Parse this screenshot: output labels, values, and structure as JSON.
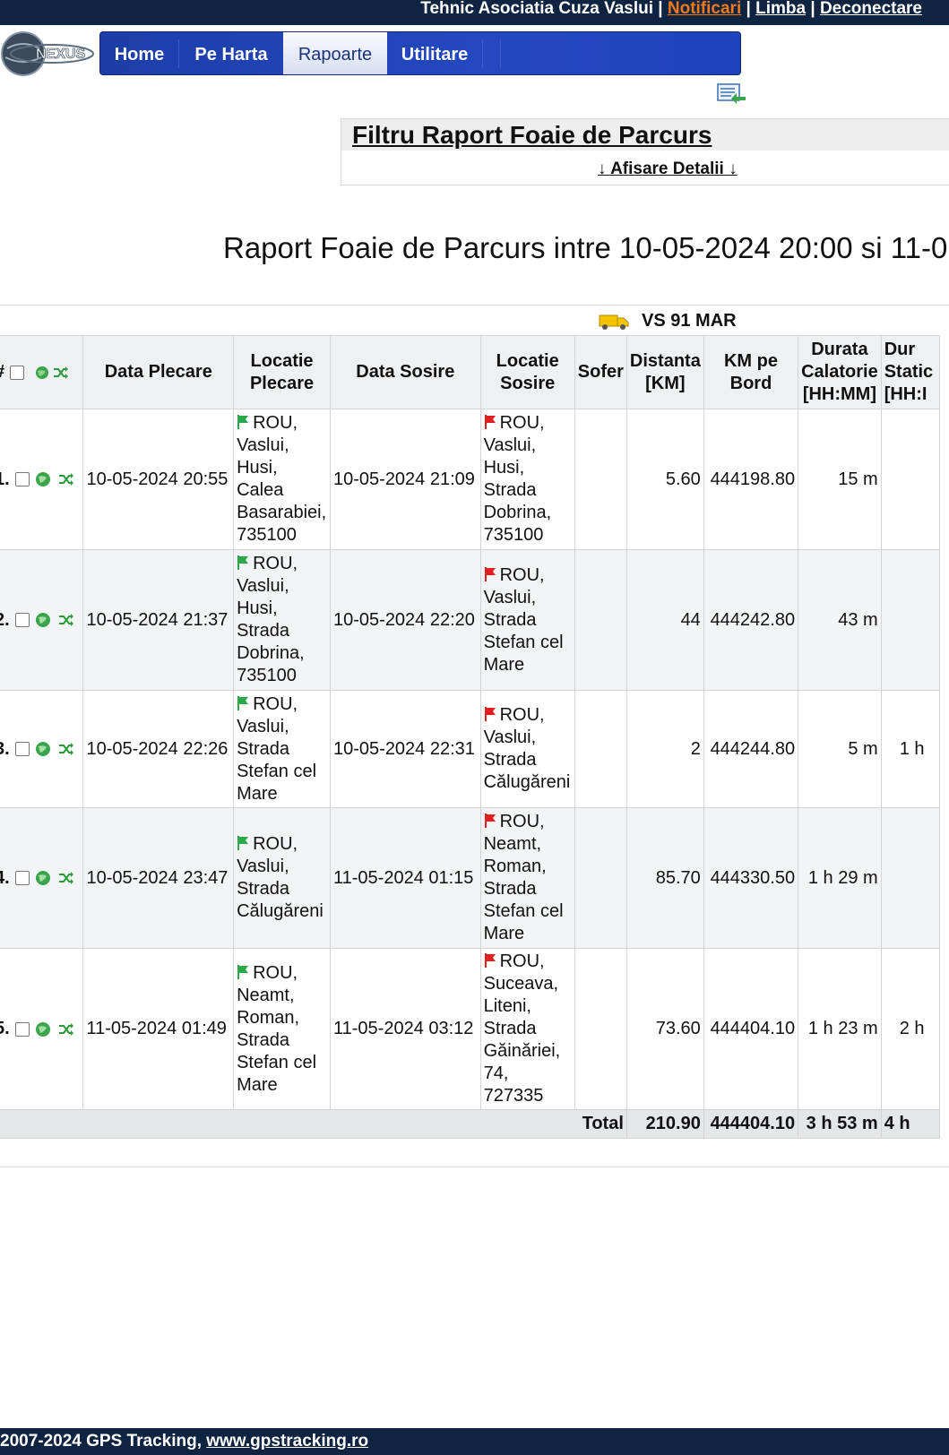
{
  "topbar": {
    "user": "Tehnic Asociatia Cuza Vaslui",
    "sep": " | ",
    "notifications": "Notificari",
    "language": "Limba",
    "logout": "Deconectare"
  },
  "nav": {
    "home": "Home",
    "map": "Pe Harta",
    "reports": "Rapoarte",
    "utilities": "Utilitare",
    "active": "Rapoarte"
  },
  "filter": {
    "title": "Filtru Raport Foaie de Parcurs",
    "details_link": "↓ Afisare Detalii ↓"
  },
  "report": {
    "title": "Raport Foaie de Parcurs intre 10-05-2024 20:00 si 11-0",
    "vehicle": "VS 91 MAR"
  },
  "columns": {
    "index": "#",
    "departure_date": "Data Plecare",
    "departure_location": "Locatie Plecare",
    "arrival_date": "Data Sosire",
    "arrival_location": "Locatie Sosire",
    "driver": "Sofer",
    "distance": "Distanta [KM]",
    "odometer": "KM pe Bord",
    "travel_duration": "Durata Calatorie [HH:MM]",
    "stop_duration": "Dur Static [HH:I"
  },
  "rows": [
    {
      "index": "1.",
      "departure_date": "10-05-2024 20:55",
      "departure_location": "ROU, Vaslui, Husi, Calea Basarabiei, 735100",
      "arrival_date": "10-05-2024 21:09",
      "arrival_location": "ROU, Vaslui, Husi, Strada Dobrina, 735100",
      "driver": "",
      "distance": "5.60",
      "odometer": "444198.80",
      "travel_duration": "15 m",
      "stop_duration": ""
    },
    {
      "index": "2.",
      "departure_date": "10-05-2024 21:37",
      "departure_location": "ROU, Vaslui, Husi, Strada Dobrina, 735100",
      "arrival_date": "10-05-2024 22:20",
      "arrival_location": "ROU, Vaslui, Strada Stefan cel Mare",
      "driver": "",
      "distance": "44",
      "odometer": "444242.80",
      "travel_duration": "43 m",
      "stop_duration": ""
    },
    {
      "index": "3.",
      "departure_date": "10-05-2024 22:26",
      "departure_location": "ROU, Vaslui, Strada Stefan cel Mare",
      "arrival_date": "10-05-2024 22:31",
      "arrival_location": "ROU, Vaslui, Strada Călugăreni",
      "driver": "",
      "distance": "2",
      "odometer": "444244.80",
      "travel_duration": "5 m",
      "stop_duration": "1 h"
    },
    {
      "index": "4.",
      "departure_date": "10-05-2024 23:47",
      "departure_location": "ROU, Vaslui, Strada Călugăreni",
      "arrival_date": "11-05-2024 01:15",
      "arrival_location": "ROU, Neamt, Roman, Strada Stefan cel Mare",
      "driver": "",
      "distance": "85.70",
      "odometer": "444330.50",
      "travel_duration": "1 h 29 m",
      "stop_duration": ""
    },
    {
      "index": "5.",
      "departure_date": "11-05-2024 01:49",
      "departure_location": "ROU, Neamt, Roman, Strada Stefan cel Mare",
      "arrival_date": "11-05-2024 03:12",
      "arrival_location": "ROU, Suceava, Liteni, Strada Găinăriei, 74, 727335",
      "driver": "",
      "distance": "73.60",
      "odometer": "444404.10",
      "travel_duration": "1 h 23 m",
      "stop_duration": "2 h"
    }
  ],
  "totals": {
    "label": "Total",
    "distance": "210.90",
    "odometer": "444404.10",
    "travel_duration": "3 h 53 m",
    "stop_duration": "4 h"
  },
  "footer": {
    "copyright": "2007-2024 GPS Tracking, ",
    "link": "www.gpstracking.ro"
  },
  "colors": {
    "header_bg": "#0f2440",
    "nav_blue": "#2348c0",
    "start_flag": "#2aa84a",
    "end_flag": "#e02020"
  }
}
